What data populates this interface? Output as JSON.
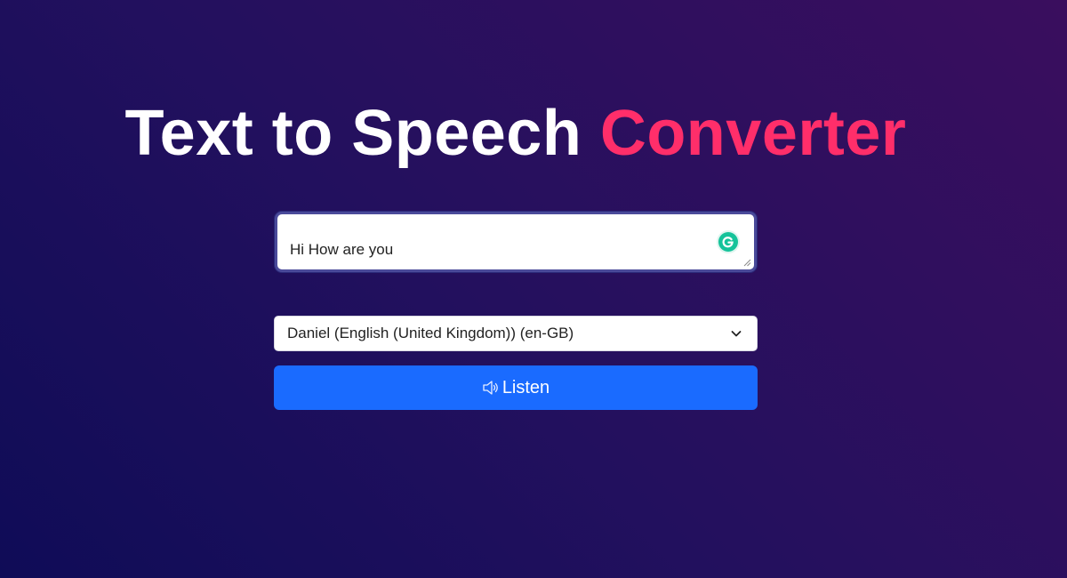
{
  "heading": {
    "part1": "Text to Speech ",
    "accent": "Converter"
  },
  "text_input": {
    "value": "Hi How are you"
  },
  "voice_select": {
    "selected": "Daniel (English (United Kingdom)) (en-GB)"
  },
  "listen_button": {
    "label": "Listen",
    "icon": "speaker-icon"
  },
  "colors": {
    "accent": "#ff2e6a",
    "button": "#1a6bff",
    "background_start": "#0f0c57",
    "background_end": "#3a0e5e"
  }
}
